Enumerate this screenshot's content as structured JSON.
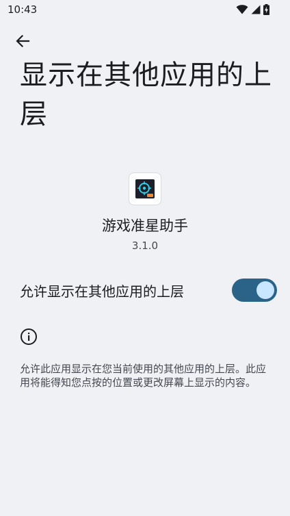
{
  "status_bar": {
    "time": "10:43",
    "icons": [
      "wifi-icon",
      "signal-icon",
      "battery-icon"
    ]
  },
  "header": {
    "back_icon": "arrow-back-icon",
    "title": "显示在其他应用的上层"
  },
  "app": {
    "name": "游戏准星助手",
    "version": "3.1.0",
    "icon": "crosshair-app-icon"
  },
  "setting": {
    "label": "允许显示在其他应用的上层",
    "enabled": true,
    "track_color": "#2a6387",
    "thumb_color": "#c8e6ff"
  },
  "info": {
    "icon": "info-icon",
    "text": "允许此应用显示在您当前使用的其他应用的上层。此应用将能得知您点按的位置或更改屏幕上显示的内容。"
  }
}
